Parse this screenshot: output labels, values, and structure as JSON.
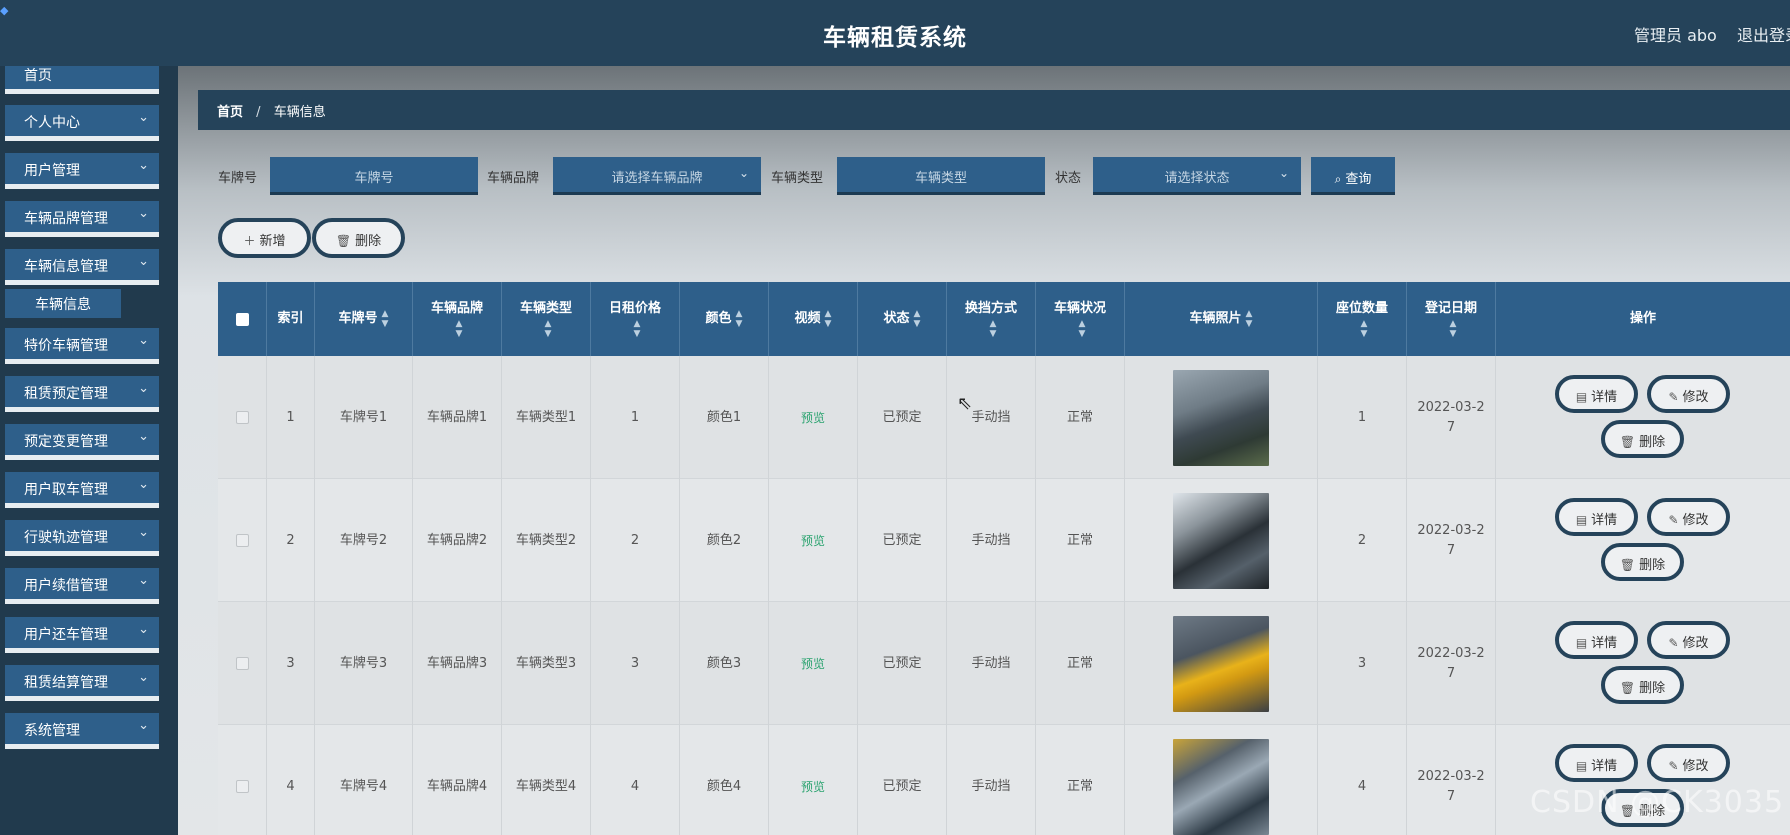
{
  "header": {
    "title": "车辆租赁系统",
    "user": "管理员 abo",
    "logout": "退出登录"
  },
  "sidebar": {
    "items": [
      {
        "label": "首页"
      },
      {
        "label": "个人中心"
      },
      {
        "label": "用户管理"
      },
      {
        "label": "车辆品牌管理"
      },
      {
        "label": "车辆信息管理"
      },
      {
        "label": "特价车辆管理"
      },
      {
        "label": "租赁预定管理"
      },
      {
        "label": "预定变更管理"
      },
      {
        "label": "用户取车管理"
      },
      {
        "label": "行驶轨迹管理"
      },
      {
        "label": "用户续借管理"
      },
      {
        "label": "用户还车管理"
      },
      {
        "label": "租赁结算管理"
      },
      {
        "label": "系统管理"
      }
    ],
    "sub_item": "车辆信息"
  },
  "breadcrumb": {
    "home": "首页",
    "separator": "/",
    "current": "车辆信息"
  },
  "filters": {
    "plate_label": "车牌号",
    "plate_placeholder": "车牌号",
    "brand_label": "车辆品牌",
    "brand_placeholder": "请选择车辆品牌",
    "type_label": "车辆类型",
    "type_placeholder": "车辆类型",
    "status_label": "状态",
    "status_placeholder": "请选择状态",
    "query_label": "查询"
  },
  "toolbar": {
    "add_label": "新增",
    "delete_label": "删除"
  },
  "table": {
    "columns": {
      "index": "索引",
      "plate": "车牌号",
      "brand": "车辆品牌",
      "type": "车辆类型",
      "price": "日租价格",
      "color": "颜色",
      "video": "视频",
      "status": "状态",
      "gear": "换挡方式",
      "condition": "车辆状况",
      "photo": "车辆照片",
      "seats": "座位数量",
      "date": "登记日期",
      "actions": "操作"
    },
    "rows": [
      {
        "index": "1",
        "plate": "车牌号1",
        "brand": "车辆品牌1",
        "type": "车辆类型1",
        "price": "1",
        "color": "颜色1",
        "video": "预览",
        "status": "已预定",
        "gear": "手动挡",
        "condition": "正常",
        "seats": "1",
        "date_a": "2022-03-2",
        "date_b": "7"
      },
      {
        "index": "2",
        "plate": "车牌号2",
        "brand": "车辆品牌2",
        "type": "车辆类型2",
        "price": "2",
        "color": "颜色2",
        "video": "预览",
        "status": "已预定",
        "gear": "手动挡",
        "condition": "正常",
        "seats": "2",
        "date_a": "2022-03-2",
        "date_b": "7"
      },
      {
        "index": "3",
        "plate": "车牌号3",
        "brand": "车辆品牌3",
        "type": "车辆类型3",
        "price": "3",
        "color": "颜色3",
        "video": "预览",
        "status": "已预定",
        "gear": "手动挡",
        "condition": "正常",
        "seats": "3",
        "date_a": "2022-03-2",
        "date_b": "7"
      },
      {
        "index": "4",
        "plate": "车牌号4",
        "brand": "车辆品牌4",
        "type": "车辆类型4",
        "price": "4",
        "color": "颜色4",
        "video": "预览",
        "status": "已预定",
        "gear": "手动挡",
        "condition": "正常",
        "seats": "4",
        "date_a": "2022-03-2",
        "date_b": "7"
      }
    ],
    "actions": {
      "detail": "详情",
      "edit": "修改",
      "delete": "删除"
    }
  },
  "watermark": "CSDN @CK3035"
}
